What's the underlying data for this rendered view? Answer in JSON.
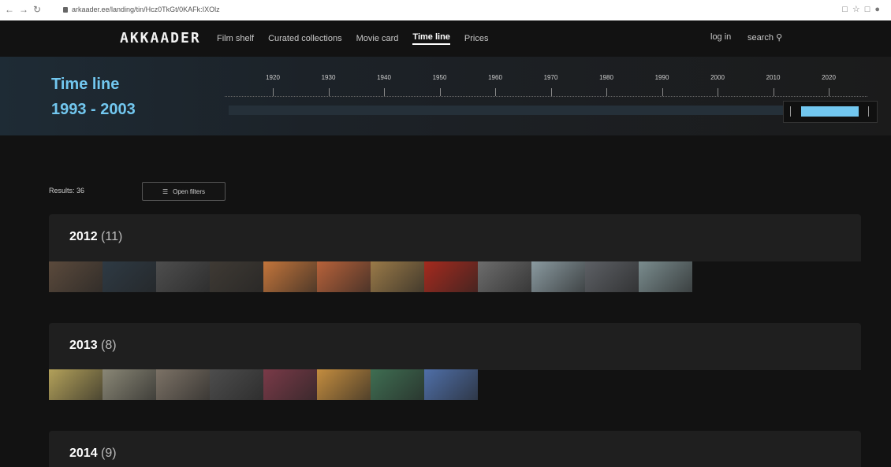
{
  "browser": {
    "url": "arkaader.ee/landing/tin/Hcz0TkGt/0KAFk:IXOlz"
  },
  "nav": {
    "logo": "AKKAADER",
    "items": [
      {
        "label": "Film shelf",
        "active": false
      },
      {
        "label": "Curated collections",
        "active": false
      },
      {
        "label": "Movie card",
        "active": false
      },
      {
        "label": "Time line",
        "active": true
      },
      {
        "label": "Prices",
        "active": false
      }
    ],
    "login": "log in",
    "search": "search"
  },
  "timeline": {
    "title": "Time line",
    "range": "1993 - 2003",
    "years": [
      "1920",
      "1930",
      "1940",
      "1950",
      "1960",
      "1970",
      "1980",
      "1990",
      "2000",
      "2010",
      "2020"
    ]
  },
  "results": {
    "label": "Results: 36",
    "filter_button": "Open filters"
  },
  "sections": [
    {
      "year": "2012",
      "count": "(11)",
      "thumb_colors": [
        "#5b4a3c",
        "#2e3a44",
        "#4e4e4e",
        "#3f3a34",
        "#c3753b",
        "#b8623a",
        "#9a7a48",
        "#a52a1e",
        "#6d6d6d",
        "#8a9aa0",
        "#5d6065",
        "#7a8c8e"
      ]
    },
    {
      "year": "2013",
      "count": "(8)",
      "thumb_colors": [
        "#b3a15a",
        "#8a8776",
        "#7c7266",
        "#4d4d4d",
        "#7a3a48",
        "#c48d3f",
        "#3f6e52",
        "#4f6fa8"
      ]
    },
    {
      "year": "2014",
      "count": "(9)",
      "thumb_colors": []
    }
  ]
}
